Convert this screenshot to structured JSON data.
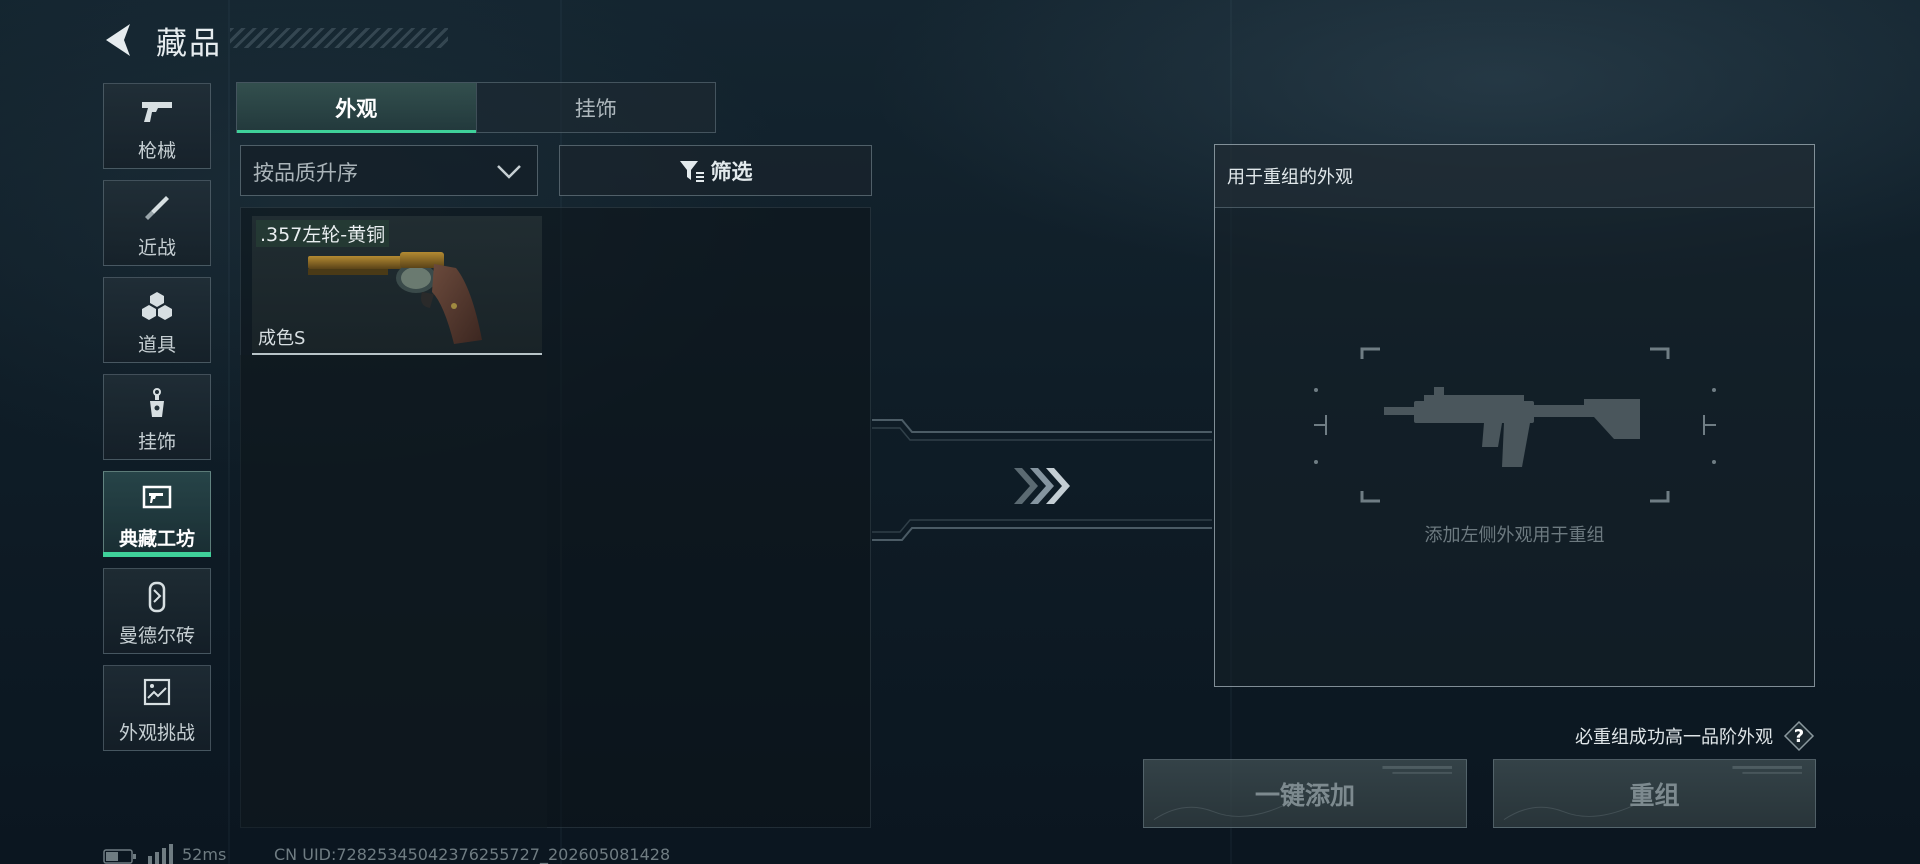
{
  "header": {
    "title": "藏品"
  },
  "sidebar": {
    "items": [
      {
        "label": "枪械",
        "icon": "pistol-icon",
        "active": false
      },
      {
        "label": "近战",
        "icon": "knife-icon",
        "active": false
      },
      {
        "label": "道具",
        "icon": "grenade-cluster-icon",
        "active": false
      },
      {
        "label": "挂饰",
        "icon": "charm-icon",
        "active": false
      },
      {
        "label": "典藏工坊",
        "icon": "workshop-frame-icon",
        "active": true
      },
      {
        "label": "曼德尔砖",
        "icon": "brick-icon",
        "active": false
      },
      {
        "label": "外观挑战",
        "icon": "challenge-map-icon",
        "active": false
      }
    ]
  },
  "tabs": [
    {
      "label": "外观",
      "active": true
    },
    {
      "label": "挂饰",
      "active": false
    }
  ],
  "sort": {
    "label": "按品质升序"
  },
  "filter": {
    "label": "筛选"
  },
  "items": [
    {
      "name": ".357左轮-黄铜",
      "grade": "成色S",
      "icon": "revolver-brass-icon"
    }
  ],
  "recombine": {
    "header": "用于重组的外观",
    "empty_hint": "添加左侧外观用于重组",
    "success_hint": "必重组成功高一品阶外观",
    "help_label": "?",
    "add_button": "一键添加",
    "recombine_button": "重组"
  },
  "status": {
    "ping": "52ms",
    "uid": "CN UID:7282534504237625572‍7_202605081428"
  },
  "colors": {
    "accent": "#3fd19a",
    "panel_border": "#afbec6",
    "background": "#0d1820"
  }
}
